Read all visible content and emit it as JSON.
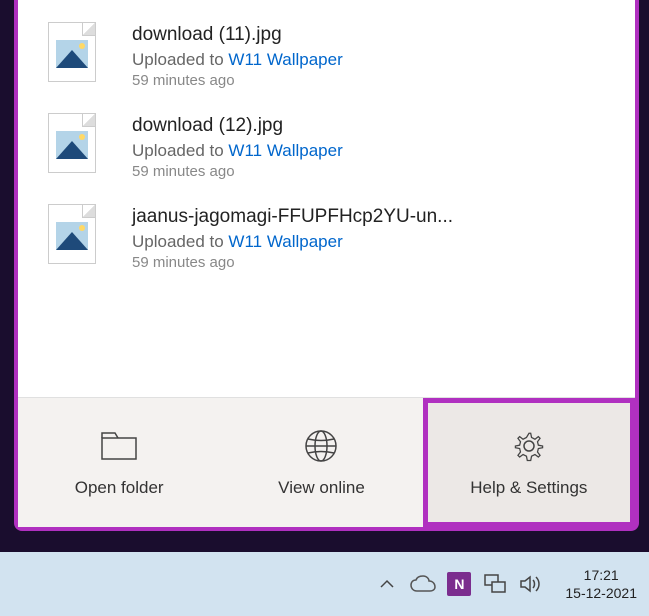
{
  "files": [
    {
      "name": "download (11).jpg",
      "status_prefix": "Uploaded to ",
      "destination": "W11 Wallpaper",
      "time": "59 minutes ago"
    },
    {
      "name": "download (12).jpg",
      "status_prefix": "Uploaded to ",
      "destination": "W11 Wallpaper",
      "time": "59 minutes ago"
    },
    {
      "name": "jaanus-jagomagi-FFUPFHcp2YU-un...",
      "status_prefix": "Uploaded to ",
      "destination": "W11 Wallpaper",
      "time": "59 minutes ago"
    }
  ],
  "actions": {
    "open_folder": "Open folder",
    "view_online": "View online",
    "help_settings": "Help & Settings"
  },
  "taskbar": {
    "time": "17:21",
    "date": "15-12-2021",
    "onenote": "N"
  }
}
